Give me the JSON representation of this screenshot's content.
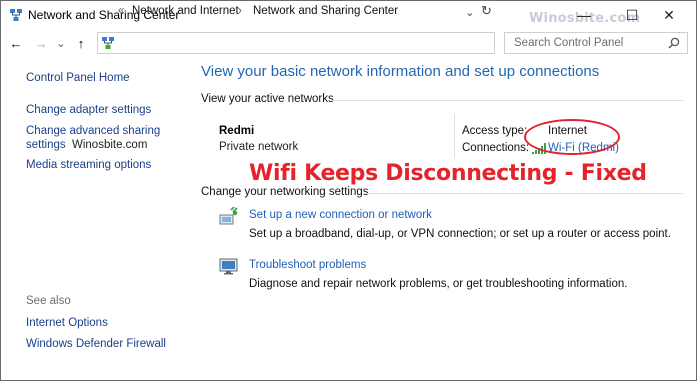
{
  "window": {
    "title": "Network and Sharing Center",
    "watermark": "Winosbite.com",
    "minimize": "—",
    "maximize": "☐",
    "close": "✕"
  },
  "nav": {
    "back": "←",
    "forward": "→",
    "recent": "⌄",
    "up": "↑"
  },
  "address": {
    "chevrons": "«",
    "crumbs": [
      "Network and Internet",
      "Network and Sharing Center"
    ],
    "separator": "›",
    "dropdown": "⌄",
    "refresh": "↻"
  },
  "search": {
    "placeholder": "Search Control Panel"
  },
  "sidebar": {
    "home": "Control Panel Home",
    "adapter": "Change adapter settings",
    "advanced_line1": "Change advanced sharing",
    "advanced_line2": "settings",
    "watermark": "Winosbite.com",
    "media": "Media streaming options",
    "see_also": "See also",
    "internet_options": "Internet Options",
    "firewall": "Windows Defender Firewall"
  },
  "main": {
    "heading": "View your basic network information and set up connections",
    "active_networks_label": "View your active networks",
    "network_name": "Redmi",
    "network_type": "Private network",
    "access_type_label": "Access type:",
    "access_type_value": "Internet",
    "connections_label": "Connections:",
    "connection_link": "Wi-Fi (Redmi)",
    "change_settings_label": "Change your networking settings",
    "setup_link": "Set up a new connection or network",
    "setup_desc": "Set up a broadband, dial-up, or VPN connection; or set up a router or access point.",
    "troubleshoot_link": "Troubleshoot problems",
    "troubleshoot_desc": "Diagnose and repair network problems, or get troubleshooting information."
  },
  "overlay": {
    "text": "Wifi Keeps Disconnecting - Fixed"
  },
  "colors": {
    "link": "#1f5fb8",
    "heading": "#2267b3",
    "overlay_red": "#e5232c"
  }
}
